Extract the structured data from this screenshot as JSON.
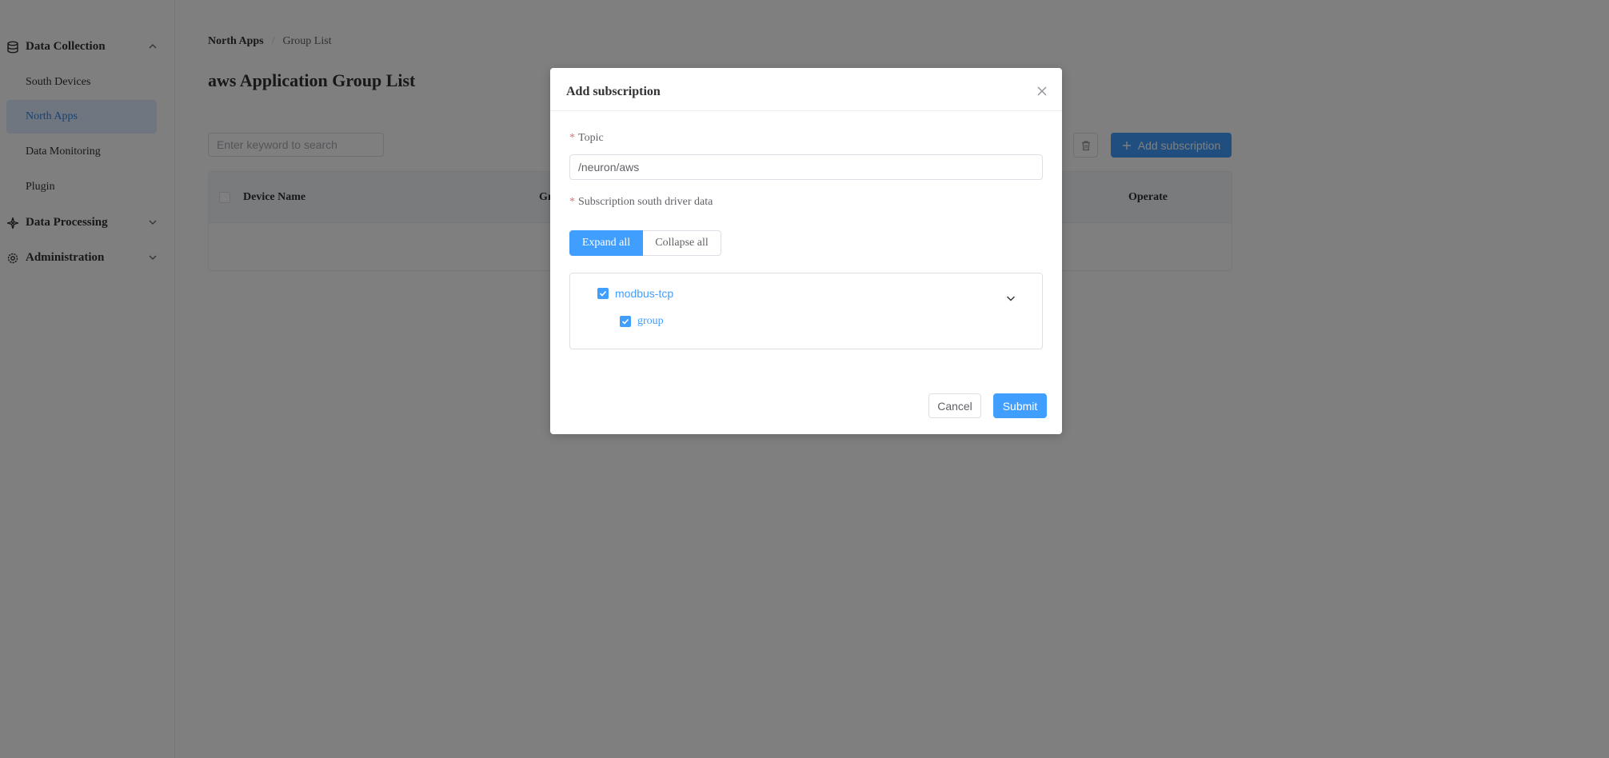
{
  "sidebar": {
    "groups": [
      {
        "label": "Data Collection",
        "icon": "database-icon",
        "expanded": true
      },
      {
        "label": "Data Processing",
        "icon": "processing-icon",
        "expanded": false
      },
      {
        "label": "Administration",
        "icon": "gear-icon",
        "expanded": false
      }
    ],
    "items": [
      {
        "label": "South Devices",
        "active": false
      },
      {
        "label": "North Apps",
        "active": true
      },
      {
        "label": "Data Monitoring",
        "active": false
      },
      {
        "label": "Plugin",
        "active": false
      }
    ]
  },
  "breadcrumb": {
    "first": "North Apps",
    "separator": "/",
    "current": "Group List"
  },
  "page_title": "aws Application Group List",
  "toolbar": {
    "search_placeholder": "Enter keyword to search",
    "add_label": "Add subscription"
  },
  "table": {
    "columns": [
      "Device Name",
      "Gr",
      "Operate"
    ]
  },
  "dialog": {
    "title": "Add subscription",
    "topic_label": "Topic",
    "topic_value": "/neuron/aws",
    "driver_label": "Subscription south driver data",
    "expand_label": "Expand all",
    "collapse_label": "Collapse all",
    "tree": [
      {
        "label": "modbus-tcp",
        "checked": true,
        "children": [
          {
            "label": "group",
            "checked": true
          }
        ]
      }
    ],
    "cancel_label": "Cancel",
    "submit_label": "Submit"
  },
  "colors": {
    "primary": "#409eff",
    "required": "#f56c6c",
    "overlay": "rgba(0,0,0,0.5)"
  }
}
